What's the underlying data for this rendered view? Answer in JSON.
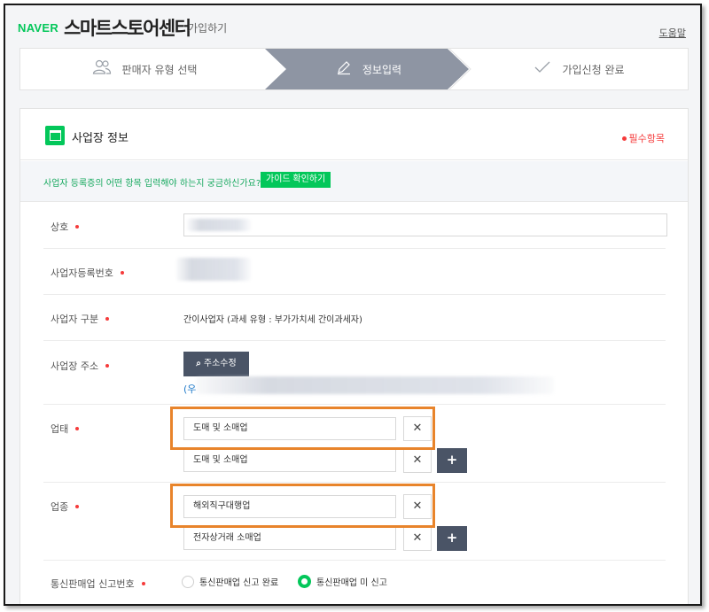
{
  "header": {
    "logo": "NAVER",
    "brand": "스마트스토어센터",
    "subtitle": "가입하기",
    "help": "도움말"
  },
  "steps": [
    {
      "label": "판매자 유형 선택",
      "icon": "users-icon",
      "active": false
    },
    {
      "label": "정보입력",
      "icon": "pencil-icon",
      "active": true
    },
    {
      "label": "가입신청 완료",
      "icon": "check-icon",
      "active": false
    }
  ],
  "section": {
    "title": "사업장 정보",
    "required_label": "필수항목",
    "guide_text": "사업자 등록증의 어떤 항목 입력해야 하는지 궁금하신가요?",
    "guide_button": "가이드 확인하기"
  },
  "fields": {
    "company_name": {
      "label": "상호",
      "value": ""
    },
    "business_number": {
      "label": "사업자등록번호",
      "value": ""
    },
    "business_type": {
      "label": "사업자 구분",
      "value": "간이사업자 (과세 유형 : 부가가치세 간이과세자)"
    },
    "address": {
      "label": "사업장 주소",
      "button": "주소수정",
      "zip_prefix": "(우"
    },
    "business_category": {
      "label": "업태",
      "values": [
        "도매 및 소매업",
        "도매 및 소매업"
      ]
    },
    "business_item": {
      "label": "업종",
      "values": [
        "해외직구대행업",
        "전자상거래 소매업"
      ]
    },
    "mail_order": {
      "label": "통신판매업 신고번호",
      "options": [
        {
          "label": "통신판매업 신고 완료",
          "selected": false
        },
        {
          "label": "통신판매업 미 신고",
          "selected": true
        }
      ]
    }
  },
  "buttons": {
    "remove": "✕",
    "add": "+"
  },
  "colors": {
    "accent": "#03c75a",
    "required": "#f53b3b",
    "highlight": "#e8842b",
    "step_active": "#8e95a3",
    "dark_button": "#4a5466"
  }
}
